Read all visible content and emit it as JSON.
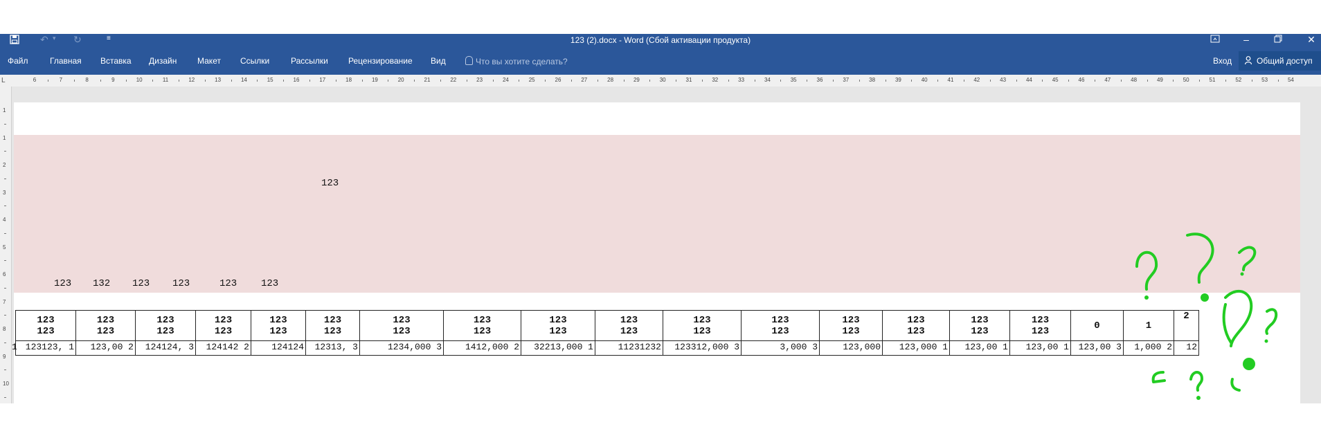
{
  "window": {
    "title": "123 (2).docx - Word (Сбой активации продукта)"
  },
  "qat": {
    "save_icon": "save-icon",
    "undo_icon": "undo-icon",
    "redo_icon": "redo-icon",
    "customize_icon": "customize-qat-icon"
  },
  "ribbon": {
    "tabs": [
      "Файл",
      "Главная",
      "Вставка",
      "Дизайн",
      "Макет",
      "Ссылки",
      "Рассылки",
      "Рецензирование",
      "Вид"
    ],
    "tell_me_placeholder": "Что вы хотите сделать?",
    "sign_in": "Вход",
    "share": "Общий доступ"
  },
  "ruler": {
    "corner": "L",
    "horizontal": [
      "6",
      "7",
      "8",
      "9",
      "10",
      "11",
      "12",
      "13",
      "14",
      "15",
      "16",
      "17",
      "18",
      "19",
      "20",
      "21",
      "22",
      "23",
      "24",
      "25",
      "26",
      "27",
      "28",
      "29",
      "30",
      "31",
      "32",
      "33",
      "34",
      "35",
      "36",
      "37",
      "38",
      "39",
      "40",
      "41",
      "42",
      "43",
      "44",
      "45",
      "46",
      "47",
      "48",
      "49",
      "50",
      "51",
      "52",
      "53",
      "54"
    ],
    "vertical": [
      "1",
      "1",
      "2",
      "3",
      "4",
      "5",
      "6",
      "7",
      "8",
      "9",
      "10"
    ]
  },
  "document": {
    "floating_text": "123",
    "row_labels": [
      "123",
      "132",
      "123",
      "123",
      "123",
      "123"
    ],
    "header_cells": [
      [
        "123",
        "123"
      ],
      [
        "123",
        "123"
      ],
      [
        "123",
        "123"
      ],
      [
        "123",
        "123"
      ],
      [
        "123",
        "123"
      ],
      [
        "123",
        "123"
      ],
      [
        "123",
        "123"
      ],
      [
        "123",
        "123"
      ],
      [
        "123",
        "123"
      ],
      [
        "123",
        "123"
      ],
      [
        "123",
        "123"
      ],
      [
        "123",
        "123"
      ],
      [
        "123",
        "123"
      ],
      [
        "123",
        "123"
      ],
      [
        "123",
        "123"
      ],
      [
        "123",
        "123"
      ],
      [
        "0"
      ],
      [
        "1"
      ],
      [
        "2"
      ]
    ],
    "value_cells": [
      "123123, 1",
      "123,00 2",
      "124124, 3",
      "124142 2",
      "124124",
      "12313, 3",
      "1234,000 3",
      "1412,000 2",
      "32213,000 1",
      "11231232",
      "123312,000 3",
      "3,000 3",
      "123,000",
      "123,000 1",
      "123,00 1",
      "123,00 1",
      "123,00 3",
      "1,000 2",
      "12"
    ],
    "left_margin_digit": "1"
  }
}
